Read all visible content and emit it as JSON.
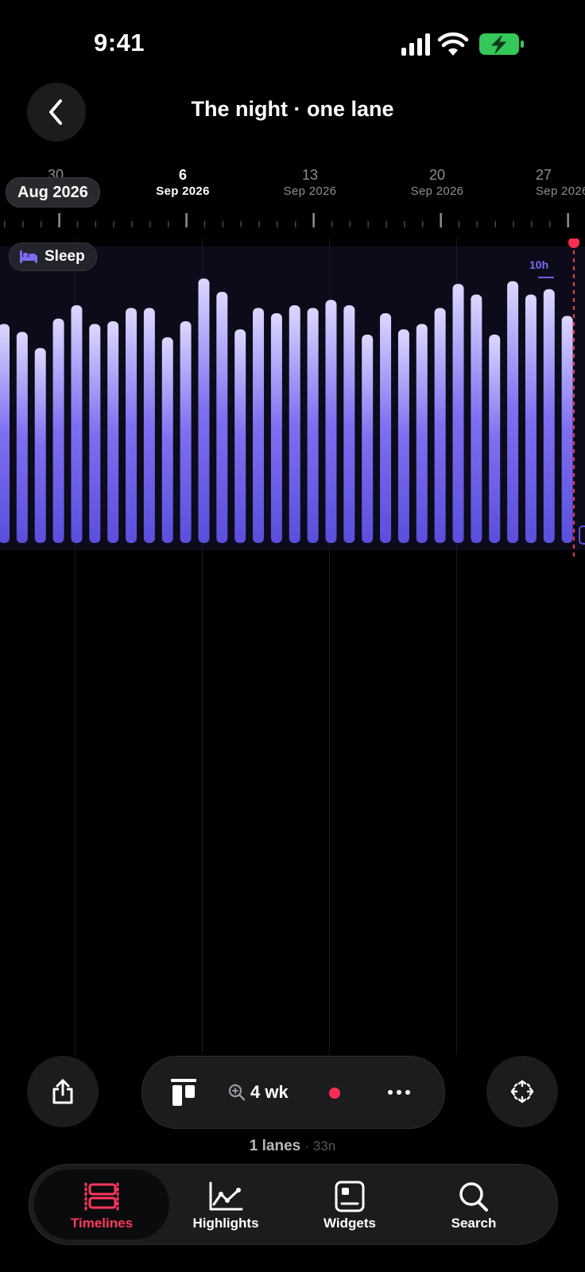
{
  "status_bar": {
    "time": "9:41"
  },
  "header": {
    "title": "The night · one lane"
  },
  "ruler": {
    "month_pill": "Aug 2026",
    "dates": [
      {
        "day": "30",
        "month": "",
        "current": false
      },
      {
        "day": "6",
        "month": "Sep 2026",
        "current": true
      },
      {
        "day": "13",
        "month": "Sep 2026",
        "current": false
      },
      {
        "day": "20",
        "month": "Sep 2026",
        "current": false
      },
      {
        "day": "27",
        "month": "Sep 2026",
        "current": false
      }
    ]
  },
  "lane": {
    "label": "Sleep",
    "icon": "bed-icon",
    "axis_label": "10h"
  },
  "chart_data": {
    "type": "bar",
    "series_color_top": "#d9d4ff",
    "series_color_bottom": "#5b4fe0",
    "ylim": [
      0,
      10
    ],
    "values": [
      8.2,
      7.9,
      7.3,
      8.4,
      8.9,
      8.2,
      8.3,
      8.8,
      8.8,
      7.7,
      8.3,
      9.9,
      9.4,
      8.0,
      8.8,
      8.6,
      8.9,
      8.8,
      9.1,
      8.9,
      7.8,
      8.6,
      8.0,
      8.2,
      8.8,
      9.7,
      9.3,
      7.8,
      9.8,
      9.3,
      9.5,
      8.5
    ]
  },
  "toolbar": {
    "zoom_label": "4 wk",
    "share_icon": "share-icon",
    "layout_icon": "layout-icon",
    "zoom_icon": "zoom-icon",
    "more_icon": "more-icon",
    "fit_icon": "fit-icon"
  },
  "summary": {
    "lanes": "1 lanes",
    "nights": "· 33n"
  },
  "tabs": [
    {
      "label": "Timelines",
      "icon": "timelines-icon",
      "active": true
    },
    {
      "label": "Highlights",
      "icon": "highlights-icon",
      "active": false
    },
    {
      "label": "Widgets",
      "icon": "widgets-icon",
      "active": false
    },
    {
      "label": "Search",
      "icon": "search-icon",
      "active": false
    }
  ],
  "colors": {
    "accent": "#ff375f",
    "lane_accent": "#7b6cf2",
    "now_marker": "#ff2d55"
  }
}
